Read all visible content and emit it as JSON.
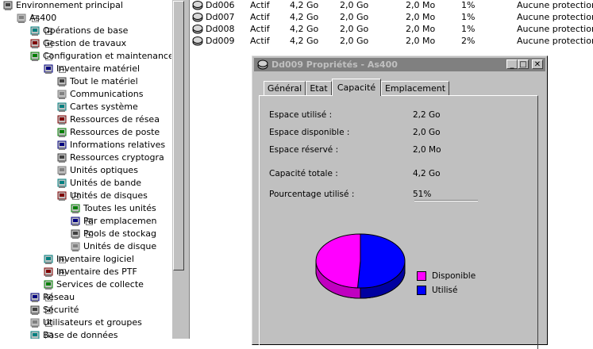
{
  "tree": {
    "items": [
      {
        "label": "Environnement principal",
        "icon": "computer-network-icon",
        "level": 0,
        "expander": ""
      },
      {
        "label": "As400",
        "icon": "server-icon",
        "level": 1,
        "expander": "−"
      },
      {
        "label": "Opérations de base",
        "icon": "basic-operations-icon",
        "level": 2,
        "expander": "+"
      },
      {
        "label": "Gestion de travaux",
        "icon": "work-management-icon",
        "level": 2,
        "expander": "+"
      },
      {
        "label": "Configuration et maintenance",
        "icon": "configuration-icon",
        "level": 2,
        "expander": "−"
      },
      {
        "label": "Inventaire matériel",
        "icon": "hardware-inventory-icon",
        "level": 3,
        "expander": "−"
      },
      {
        "label": "Tout le matériel",
        "icon": "all-hardware-icon",
        "level": 4,
        "expander": ""
      },
      {
        "label": "Communications",
        "icon": "communications-icon",
        "level": 4,
        "expander": ""
      },
      {
        "label": "Cartes système",
        "icon": "system-cards-icon",
        "level": 4,
        "expander": ""
      },
      {
        "label": "Ressources de résea",
        "icon": "network-resources-icon",
        "level": 4,
        "expander": ""
      },
      {
        "label": "Ressources de poste",
        "icon": "workstation-resources-icon",
        "level": 4,
        "expander": ""
      },
      {
        "label": "Informations relatives",
        "icon": "processor-info-icon",
        "level": 4,
        "expander": ""
      },
      {
        "label": "Ressources cryptogra",
        "icon": "cryptographic-resources-icon",
        "level": 4,
        "expander": ""
      },
      {
        "label": "Unités optiques",
        "icon": "optical-units-icon",
        "level": 4,
        "expander": ""
      },
      {
        "label": "Unités de bande",
        "icon": "tape-units-icon",
        "level": 4,
        "expander": ""
      },
      {
        "label": "Unités de disques",
        "icon": "disk-units-icon",
        "level": 4,
        "expander": "−"
      },
      {
        "label": "Toutes les unités",
        "icon": "all-disk-units-icon",
        "level": 5,
        "expander": ""
      },
      {
        "label": "Par emplacemen",
        "icon": "by-location-icon",
        "level": 5,
        "expander": "+"
      },
      {
        "label": "Pools de stockag",
        "icon": "storage-pools-icon",
        "level": 5,
        "expander": "+"
      },
      {
        "label": "Unités de disque",
        "icon": "nonconfigured-disk-icon",
        "level": 5,
        "expander": ""
      },
      {
        "label": "Inventaire logiciel",
        "icon": "software-inventory-icon",
        "level": 3,
        "expander": "+"
      },
      {
        "label": "Inventaire des PTF",
        "icon": "ptf-inventory-icon",
        "level": 3,
        "expander": "+"
      },
      {
        "label": "Services de collecte",
        "icon": "collection-services-icon",
        "level": 3,
        "expander": ""
      },
      {
        "label": "Réseau",
        "icon": "network-icon",
        "level": 2,
        "expander": "+"
      },
      {
        "label": "Sécurité",
        "icon": "security-icon",
        "level": 2,
        "expander": "+"
      },
      {
        "label": "Utilisateurs et groupes",
        "icon": "users-groups-icon",
        "level": 2,
        "expander": "+"
      },
      {
        "label": "Base de données",
        "icon": "database-icon",
        "level": 2,
        "expander": "+"
      }
    ]
  },
  "list": {
    "rows": [
      {
        "name": "Dd006",
        "status": "Actif",
        "capacity": "4,2 Go",
        "available": "2,0 Go",
        "reserved": "2,0 Mo",
        "used_pct": "1%",
        "protection": "Aucune protection"
      },
      {
        "name": "Dd007",
        "status": "Actif",
        "capacity": "4,2 Go",
        "available": "2,0 Go",
        "reserved": "2,0 Mo",
        "used_pct": "1%",
        "protection": "Aucune protection"
      },
      {
        "name": "Dd008",
        "status": "Actif",
        "capacity": "4,2 Go",
        "available": "2,0 Go",
        "reserved": "2,0 Mo",
        "used_pct": "1%",
        "protection": "Aucune protection"
      },
      {
        "name": "Dd009",
        "status": "Actif",
        "capacity": "4,2 Go",
        "available": "2,0 Go",
        "reserved": "2,0 Mo",
        "used_pct": "2%",
        "protection": "Aucune protection"
      }
    ]
  },
  "dialog": {
    "title": "Dd009 Propriétés - As400",
    "minimize": "_",
    "maximize": "□",
    "close": "✕",
    "tabs": [
      "Général",
      "Etat",
      "Capacité",
      "Emplacement"
    ],
    "active_tab": 2,
    "fields": {
      "used_label": "Espace utilisé :",
      "used_value": "2,2 Go",
      "available_label": "Espace disponible :",
      "available_value": "2,0 Go",
      "reserved_label": "Espace réservé :",
      "reserved_value": "2,0 Mo",
      "total_label": "Capacité totale :",
      "total_value": "4,2 Go",
      "percent_label": "Pourcentage utilisé :",
      "percent_value": "51%"
    },
    "legend": {
      "available": "Disponible",
      "used": "Utilisé"
    },
    "colors": {
      "available": "#ff00ff",
      "used": "#0000ff",
      "title_bar": "#808080"
    }
  },
  "chart_data": {
    "type": "pie",
    "categories": [
      "Disponible",
      "Utilisé"
    ],
    "values": [
      49,
      51
    ]
  }
}
